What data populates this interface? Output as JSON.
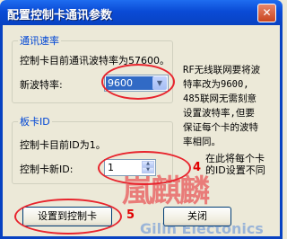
{
  "window": {
    "title": "配置控制卡通讯参数",
    "close_glyph": "✕"
  },
  "speed_group": {
    "legend": "通讯速率",
    "current_label": "控制卡目前通讯波特率为57600。",
    "new_label": "新波特率:",
    "new_value": "9600"
  },
  "id_group": {
    "legend": "板卡ID",
    "current_label": "控制卡目前ID为1。",
    "new_label": "控制卡新ID:",
    "new_value": "1"
  },
  "annotations": {
    "note1": [
      "RF无线联网要将波",
      "特率改为9600,",
      "485联网无需刻意",
      "设置波特率,但要",
      "保证每个卡的波特",
      "率相同。"
    ],
    "note2": [
      "在此将每个卡",
      "的ID设置不同"
    ],
    "marker4": "4",
    "marker5": "5"
  },
  "buttons": {
    "apply": "设置到控制卡",
    "close": "关闭"
  },
  "watermark": {
    "glyphs": "嵐麒麟",
    "text": "Gilin Electonics"
  },
  "colors": {
    "title_bar": "#0a4bd6",
    "legend": "#0046d5",
    "annotation_red": "#e8242d",
    "selected": "#316ac5"
  }
}
